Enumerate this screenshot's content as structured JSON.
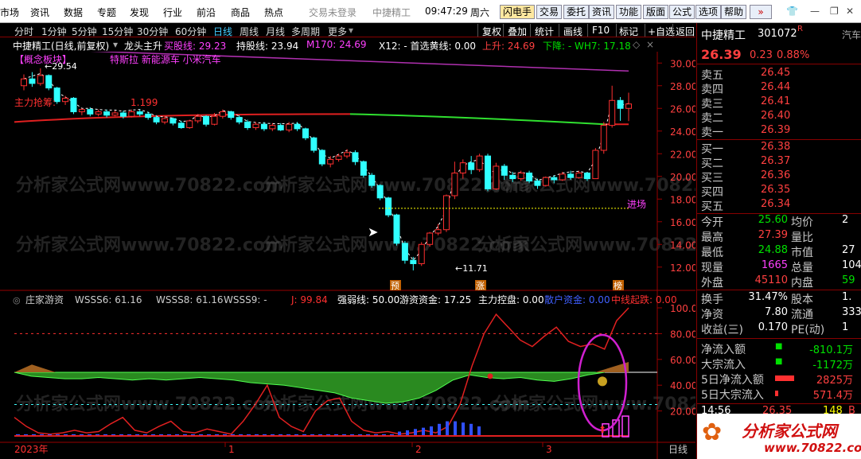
{
  "top_menu": [
    "市场",
    "资讯",
    "数据",
    "专题",
    "发现",
    "行业",
    "前沿",
    "商品",
    "热点"
  ],
  "top_status": {
    "login": "交易未登录",
    "broker": "中捷精工",
    "time": "09:47:29",
    "weekday": "周六"
  },
  "top_buttons": [
    "闪电手",
    "交易",
    "委托",
    "资讯",
    "功能",
    "版面",
    "公式",
    "选项",
    "帮助"
  ],
  "nav_periods": [
    "分时",
    "1分钟",
    "5分钟",
    "15分钟",
    "30分钟",
    "60分钟",
    "日线",
    "周线",
    "月线",
    "多周期",
    "更多"
  ],
  "nav_active": "日线",
  "nav_tools": [
    "复权",
    "叠加",
    "统计",
    "画线",
    "F10",
    "标记",
    "+自选",
    "返回"
  ],
  "info": {
    "stock": "中捷精工(日线,前复权)",
    "ind": "龙头主升",
    "buy_line": "买股线: 29.23",
    "hold_line": "持股线: 23.94",
    "m170": "M170: 24.69",
    "x12": "X12: - 首选黄线: 0.00",
    "up": "上升: 24.69",
    "down": "下降: - WH7: 17.18"
  },
  "chart_labels": {
    "concept": "【概念板块】",
    "concept_text": "特斯拉 新能源车 小米汽车",
    "force": "主力抢筹:",
    "force_val": "1.199",
    "hi_mark": "29.54",
    "lo_mark": "11.71",
    "entry": "进场",
    "tag1": "预",
    "tag2": "涨",
    "tag3": "榜"
  },
  "price_axis": [
    "30.00",
    "28.00",
    "26.00",
    "24.00",
    "22.00",
    "20.00",
    "18.00",
    "16.00",
    "14.00",
    "12.00"
  ],
  "sub": {
    "name": "庄家游资",
    "wsss6": "WSSS6: 61.16",
    "wsss8": "WSSS8: 61.16",
    "wsss9": "WSSS9: -",
    "j": "J: 99.84",
    "strong": "强弱线: 50.00",
    "hot": "游资资金: 17.25",
    "main": "主力控盘: 0.00",
    "retail": "散户资金: 0.00",
    "mid": "中线起跌: 0.00"
  },
  "sub_axis": [
    "100.00",
    "80.00",
    "60.00",
    "40.00",
    "20.00"
  ],
  "time_axis": {
    "year": "2023年",
    "m1": "1",
    "m2": "2",
    "m3": "3",
    "right": "日线"
  },
  "side": {
    "name": "中捷精工",
    "code": "301072",
    "r": "R",
    "tab": "汽车",
    "price": "26.39",
    "chg": "0.23",
    "pct": "0.88%",
    "sell": [
      [
        "卖五",
        "26.45"
      ],
      [
        "卖四",
        "26.44"
      ],
      [
        "卖三",
        "26.41"
      ],
      [
        "卖二",
        "26.40"
      ],
      [
        "卖一",
        "26.39"
      ]
    ],
    "buy": [
      [
        "买一",
        "26.38"
      ],
      [
        "买二",
        "26.37"
      ],
      [
        "买三",
        "26.36"
      ],
      [
        "买四",
        "26.35"
      ],
      [
        "买五",
        "26.34"
      ]
    ],
    "stats": [
      [
        "今开",
        "25.60",
        "均价",
        "2"
      ],
      [
        "最高",
        "27.39",
        "量比",
        ""
      ],
      [
        "最低",
        "24.88",
        "市值",
        "27"
      ],
      [
        "现量",
        "1665",
        "总量",
        "104"
      ],
      [
        "外盘",
        "45110",
        "内盘",
        "59"
      ]
    ],
    "stats2": [
      [
        "换手",
        "31.47%",
        "股本",
        "1."
      ],
      [
        "净资",
        "7.80",
        "流通",
        "333"
      ],
      [
        "收益(三)",
        "0.170",
        "PE(动)",
        "1"
      ]
    ],
    "flow": [
      [
        "净流入额",
        "-810.1万"
      ],
      [
        "大宗流入",
        "-1172万"
      ],
      [
        "5日净流入额",
        "2825万"
      ],
      [
        "5日大宗流入",
        "571.4万"
      ]
    ],
    "tick": [
      "14:56",
      "26.35",
      "148",
      "B"
    ]
  },
  "watermark": "分析家公式网www.70822.com",
  "logo": {
    "text": "分析家公式网",
    "url": "www.70822.com"
  },
  "chart_data": {
    "type": "candlestick",
    "candles": [
      [
        28.0,
        28.6,
        29.0,
        27.6
      ],
      [
        28.6,
        28.2,
        29.2,
        27.9
      ],
      [
        28.2,
        28.9,
        29.54,
        28.0
      ],
      [
        28.9,
        27.8,
        29.0,
        27.6
      ],
      [
        27.8,
        26.6,
        27.9,
        26.4
      ],
      [
        26.6,
        26.9,
        27.1,
        26.3
      ],
      [
        26.9,
        25.7,
        27.0,
        25.5
      ],
      [
        25.7,
        25.9,
        26.0,
        25.4
      ],
      [
        25.9,
        25.5,
        26.1,
        25.3
      ],
      [
        25.5,
        25.7,
        25.9,
        25.3
      ],
      [
        25.7,
        25.4,
        25.9,
        25.2
      ],
      [
        25.4,
        25.6,
        25.8,
        25.3
      ],
      [
        25.6,
        25.3,
        25.8,
        25.1
      ],
      [
        25.3,
        25.7,
        25.9,
        25.2
      ],
      [
        25.7,
        25.5,
        25.9,
        25.3
      ],
      [
        25.5,
        25.2,
        25.7,
        25.0
      ],
      [
        25.2,
        24.8,
        25.4,
        24.6
      ],
      [
        24.8,
        25.1,
        25.3,
        24.6
      ],
      [
        25.1,
        24.7,
        25.2,
        24.5
      ],
      [
        24.7,
        24.3,
        24.9,
        24.2
      ],
      [
        24.3,
        24.9,
        25.0,
        24.2
      ],
      [
        24.9,
        25.3,
        25.5,
        24.7
      ],
      [
        25.3,
        24.6,
        25.4,
        24.4
      ],
      [
        24.6,
        25.3,
        25.6,
        24.5
      ],
      [
        25.3,
        25.7,
        25.9,
        25.1
      ],
      [
        25.7,
        25.2,
        25.8,
        25.0
      ],
      [
        25.2,
        24.8,
        25.4,
        24.6
      ],
      [
        24.8,
        24.3,
        25.0,
        24.1
      ],
      [
        24.3,
        24.6,
        24.8,
        24.1
      ],
      [
        24.6,
        24.2,
        24.8,
        24.0
      ],
      [
        24.2,
        24.5,
        24.7,
        24.0
      ],
      [
        24.5,
        24.1,
        24.7,
        24.0
      ],
      [
        24.1,
        24.6,
        24.8,
        23.9
      ],
      [
        24.6,
        24.2,
        24.8,
        24.0
      ],
      [
        24.2,
        23.4,
        24.3,
        23.2
      ],
      [
        23.4,
        22.3,
        23.5,
        22.1
      ],
      [
        22.3,
        21.1,
        22.4,
        20.9
      ],
      [
        21.1,
        21.5,
        21.8,
        20.8
      ],
      [
        21.5,
        21.8,
        22.0,
        21.3
      ],
      [
        21.8,
        22.1,
        22.4,
        21.6
      ],
      [
        22.1,
        21.3,
        22.3,
        21.0
      ],
      [
        21.3,
        20.1,
        21.4,
        19.9
      ],
      [
        20.1,
        19.2,
        20.3,
        19.0
      ],
      [
        19.2,
        18.1,
        19.3,
        17.9
      ],
      [
        18.1,
        16.6,
        18.2,
        16.4
      ],
      [
        16.6,
        14.1,
        16.7,
        13.9
      ],
      [
        14.1,
        12.6,
        14.3,
        12.3
      ],
      [
        12.6,
        12.3,
        12.9,
        11.71
      ],
      [
        12.3,
        14.0,
        14.2,
        12.1
      ],
      [
        14.0,
        15.0,
        15.1,
        13.8
      ],
      [
        15.0,
        15.3,
        15.8,
        14.8
      ],
      [
        15.3,
        18.3,
        18.4,
        15.1
      ],
      [
        18.3,
        20.3,
        21.3,
        18.0
      ],
      [
        20.3,
        21.2,
        21.5,
        19.8
      ],
      [
        21.2,
        20.6,
        21.8,
        20.2
      ],
      [
        20.6,
        21.8,
        22.0,
        20.4
      ],
      [
        21.8,
        18.9,
        22.0,
        18.7
      ],
      [
        18.9,
        20.9,
        21.2,
        18.8
      ],
      [
        20.9,
        20.1,
        21.1,
        19.7
      ],
      [
        20.1,
        19.8,
        20.4,
        19.5
      ],
      [
        19.8,
        20.3,
        20.5,
        19.6
      ],
      [
        20.3,
        19.6,
        20.5,
        19.4
      ],
      [
        19.6,
        19.2,
        19.8,
        18.9
      ],
      [
        19.2,
        19.9,
        20.0,
        19.1
      ],
      [
        19.9,
        19.7,
        20.1,
        19.4
      ],
      [
        19.7,
        20.2,
        20.4,
        19.6
      ],
      [
        20.2,
        19.9,
        20.5,
        19.7
      ],
      [
        19.9,
        20.3,
        20.5,
        19.8
      ],
      [
        20.3,
        19.8,
        20.4,
        19.6
      ],
      [
        19.8,
        22.3,
        22.5,
        19.8
      ],
      [
        22.3,
        24.5,
        24.8,
        22.0
      ],
      [
        24.5,
        26.7,
        28.0,
        24.3
      ],
      [
        26.7,
        26.0,
        27.0,
        24.9
      ],
      [
        26.0,
        26.39,
        27.39,
        24.88
      ]
    ],
    "price_range": [
      11.0,
      31.0
    ]
  }
}
